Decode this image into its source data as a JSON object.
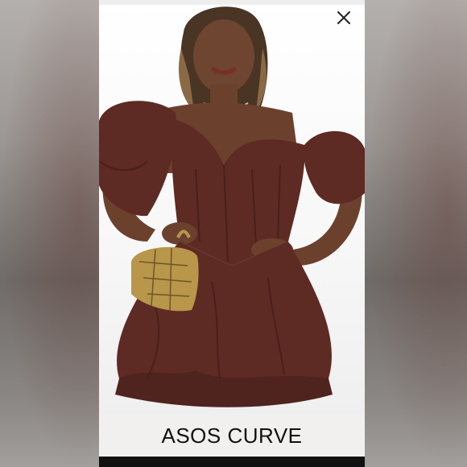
{
  "status_bar": {
    "left": "",
    "right": ""
  },
  "close": {
    "icon": "close-icon"
  },
  "product_image": {
    "subject": "model-in-dress",
    "dress_color": "#5e2a24",
    "bag_color": "#b8964a"
  },
  "caption": {
    "brand": "ASOS CURVE"
  }
}
